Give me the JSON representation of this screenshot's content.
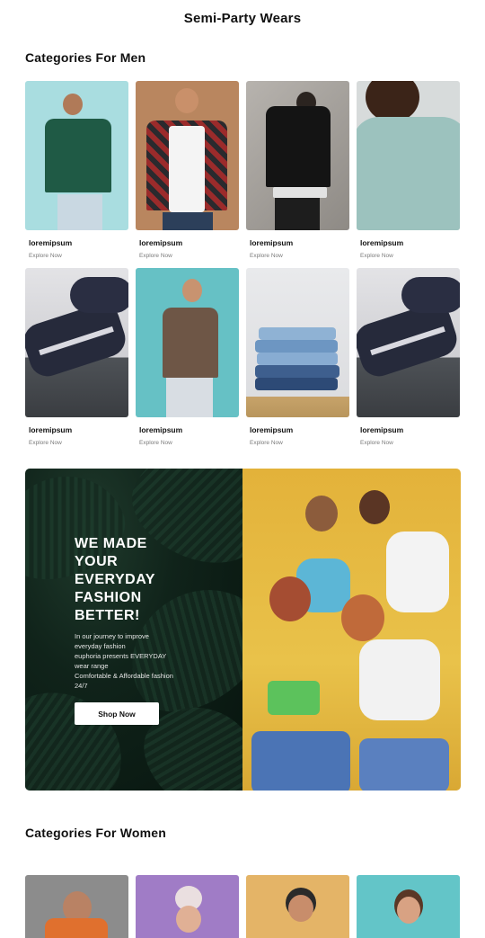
{
  "page": {
    "title": "Semi-Party Wears"
  },
  "men_section": {
    "title": "Categories For Men",
    "cards": [
      {
        "title": "loremipsum",
        "link": "Explore Now"
      },
      {
        "title": "loremipsum",
        "link": "Explore Now"
      },
      {
        "title": "loremipsum",
        "link": "Explore Now"
      },
      {
        "title": "loremipsum",
        "link": "Explore Now"
      },
      {
        "title": "loremipsum",
        "link": "Explore Now"
      },
      {
        "title": "loremipsum",
        "link": "Explore Now"
      },
      {
        "title": "loremipsum",
        "link": "Explore Now"
      },
      {
        "title": "loremipsum",
        "link": "Explore Now"
      }
    ]
  },
  "banner": {
    "headline": [
      "WE MADE",
      "YOUR",
      "EVERYDAY",
      "FASHION",
      "BETTER!"
    ],
    "copy": [
      "In our journey to improve",
      "everyday fashion",
      "euphoria presents EVERYDAY",
      "wear range",
      "Comfortable & Affordable fashion",
      "24/7"
    ],
    "cta_label": "Shop Now"
  },
  "women_section": {
    "title": "Categories For Women"
  }
}
